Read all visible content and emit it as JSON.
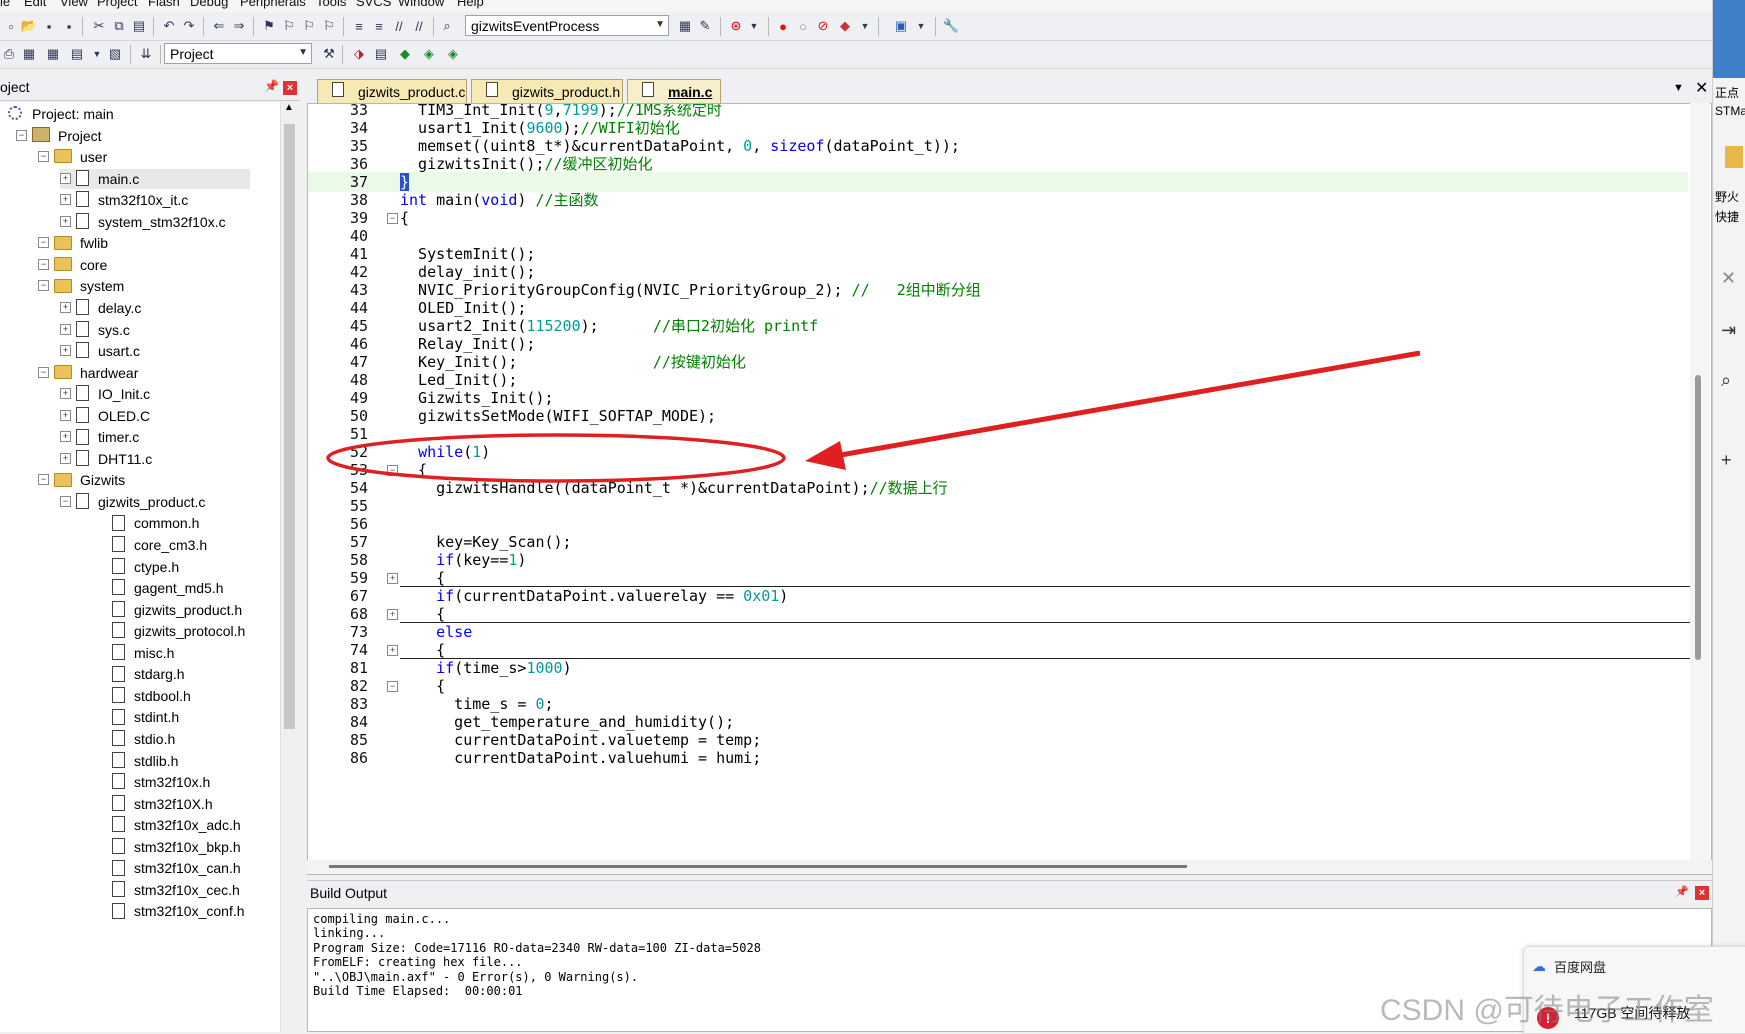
{
  "menu": [
    "le",
    "Edit",
    "View",
    "Project",
    "Flash",
    "Debug",
    "Peripherals",
    "Tools",
    "SVCS",
    "Window",
    "Help"
  ],
  "toolbar": {
    "function_combo": "gizwitsEventProcess",
    "target_combo": "Project"
  },
  "project_panel": {
    "title": "oject",
    "tree": [
      {
        "label": "Project: main",
        "type": "root"
      },
      {
        "label": "Project",
        "type": "project"
      },
      {
        "label": "user",
        "type": "folder"
      },
      {
        "label": "main.c",
        "type": "file"
      },
      {
        "label": "stm32f10x_it.c",
        "type": "file"
      },
      {
        "label": "system_stm32f10x.c",
        "type": "file"
      },
      {
        "label": "fwlib",
        "type": "folder"
      },
      {
        "label": "core",
        "type": "folder"
      },
      {
        "label": "system",
        "type": "folder"
      },
      {
        "label": "delay.c",
        "type": "file"
      },
      {
        "label": "sys.c",
        "type": "file"
      },
      {
        "label": "usart.c",
        "type": "file"
      },
      {
        "label": "hardwear",
        "type": "folder"
      },
      {
        "label": "IO_Init.c",
        "type": "file"
      },
      {
        "label": "OLED.C",
        "type": "file"
      },
      {
        "label": "timer.c",
        "type": "file"
      },
      {
        "label": "DHT11.c",
        "type": "file"
      },
      {
        "label": "Gizwits",
        "type": "folder"
      },
      {
        "label": "gizwits_product.c",
        "type": "file"
      },
      {
        "label": "common.h",
        "type": "header"
      },
      {
        "label": "core_cm3.h",
        "type": "header"
      },
      {
        "label": "ctype.h",
        "type": "header"
      },
      {
        "label": "gagent_md5.h",
        "type": "header"
      },
      {
        "label": "gizwits_product.h",
        "type": "header"
      },
      {
        "label": "gizwits_protocol.h",
        "type": "header"
      },
      {
        "label": "misc.h",
        "type": "header"
      },
      {
        "label": "stdarg.h",
        "type": "header"
      },
      {
        "label": "stdbool.h",
        "type": "header"
      },
      {
        "label": "stdint.h",
        "type": "header"
      },
      {
        "label": "stdio.h",
        "type": "header"
      },
      {
        "label": "stdlib.h",
        "type": "header"
      },
      {
        "label": "stm32f10x.h",
        "type": "header"
      },
      {
        "label": "stm32f10X.h",
        "type": "header"
      },
      {
        "label": "stm32f10x_adc.h",
        "type": "header"
      },
      {
        "label": "stm32f10x_bkp.h",
        "type": "header"
      },
      {
        "label": "stm32f10x_can.h",
        "type": "header"
      },
      {
        "label": "stm32f10x_cec.h",
        "type": "header"
      },
      {
        "label": "stm32f10x_conf.h",
        "type": "header"
      }
    ]
  },
  "tabs": [
    {
      "label": "gizwits_product.c",
      "active": false
    },
    {
      "label": "gizwits_product.h",
      "active": false
    },
    {
      "label": "main.c",
      "active": true
    }
  ],
  "code_lines": [
    {
      "n": "33",
      "text": "  TIM3_Int_Init(9,7199);//1MS系统定时"
    },
    {
      "n": "34",
      "text": "  usart1_Init(9600);//WIFI初始化"
    },
    {
      "n": "35",
      "text": "  memset((uint8_t*)&currentDataPoint, 0, sizeof(dataPoint_t));"
    },
    {
      "n": "36",
      "text": "  gizwitsInit();//缓冲区初始化"
    },
    {
      "n": "37",
      "text": "}"
    },
    {
      "n": "38",
      "text": "int main(void) //主函数"
    },
    {
      "n": "39",
      "text": "{"
    },
    {
      "n": "40",
      "text": ""
    },
    {
      "n": "41",
      "text": "  SystemInit();"
    },
    {
      "n": "42",
      "text": "  delay_init();"
    },
    {
      "n": "43",
      "text": "  NVIC_PriorityGroupConfig(NVIC_PriorityGroup_2); //   2组中断分组"
    },
    {
      "n": "44",
      "text": "  OLED_Init();"
    },
    {
      "n": "45",
      "text": "  usart2_Init(115200);      //串口2初始化 printf"
    },
    {
      "n": "46",
      "text": "  Relay_Init();"
    },
    {
      "n": "47",
      "text": "  Key_Init();               //按键初始化"
    },
    {
      "n": "48",
      "text": "  Led_Init();"
    },
    {
      "n": "49",
      "text": "  Gizwits_Init();"
    },
    {
      "n": "50",
      "text": "  gizwitsSetMode(WIFI_SOFTAP_MODE);"
    },
    {
      "n": "51",
      "text": ""
    },
    {
      "n": "52",
      "text": "  while(1)"
    },
    {
      "n": "53",
      "text": "  {"
    },
    {
      "n": "54",
      "text": "    gizwitsHandle((dataPoint_t *)&currentDataPoint);//数据上行"
    },
    {
      "n": "55",
      "text": ""
    },
    {
      "n": "56",
      "text": ""
    },
    {
      "n": "57",
      "text": "    key=Key_Scan();"
    },
    {
      "n": "58",
      "text": "    if(key==1)"
    },
    {
      "n": "59",
      "text": "    {"
    },
    {
      "n": "67",
      "text": "    if(currentDataPoint.valuerelay == 0x01)"
    },
    {
      "n": "68",
      "text": "    {"
    },
    {
      "n": "73",
      "text": "    else"
    },
    {
      "n": "74",
      "text": "    {"
    },
    {
      "n": "81",
      "text": "    if(time_s>1000)"
    },
    {
      "n": "82",
      "text": "    {"
    },
    {
      "n": "83",
      "text": "      time_s = 0;"
    },
    {
      "n": "84",
      "text": "      get_temperature_and_humidity();"
    },
    {
      "n": "85",
      "text": "      currentDataPoint.valuetemp = temp;"
    },
    {
      "n": "86",
      "text": "      currentDataPoint.valuehumi = humi;"
    }
  ],
  "build_output": {
    "title": "Build Output",
    "lines": [
      "compiling main.c...",
      "linking...",
      "Program Size: Code=17116 RO-data=2340 RW-data=100 ZI-data=5028",
      "FromELF: creating hex file...",
      "\"..\\OBJ\\main.axf\" - 0 Error(s), 0 Warning(s).",
      "Build Time Elapsed:  00:00:01"
    ]
  },
  "side_window": {
    "text1": "正点",
    "text2": "STMa",
    "text3": "野火",
    "text4": "快捷"
  },
  "notification": {
    "app": "百度网盘",
    "message": "117GB 空间待释放"
  },
  "watermark": "CSDN @可待电子工作室",
  "colors": {
    "annotation": "#e02020",
    "keyword": "#0000ff",
    "comment": "#008000",
    "number": "#009c9c"
  }
}
